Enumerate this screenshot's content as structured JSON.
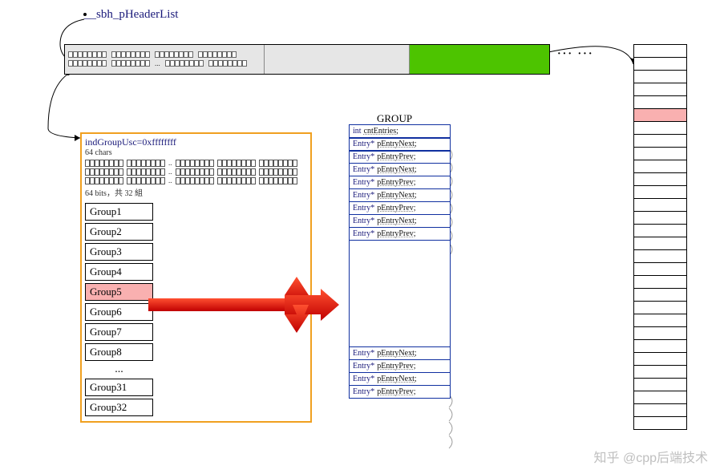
{
  "header": {
    "label": "__sbh_pHeaderList",
    "trailing_dots": "··· ···"
  },
  "orange": {
    "ind_label": "indGroupUsc=0xffffffff",
    "chars_label": "64 chars",
    "note": "64 bits，共 32 組",
    "groups": [
      "Group1",
      "Group2",
      "Group3",
      "Group4",
      "Group5",
      "Group6",
      "Group7",
      "Group8"
    ],
    "groups_dots": "...",
    "groups_tail": [
      "Group31",
      "Group32"
    ],
    "highlight_index": 4
  },
  "group_struct": {
    "title": "GROUP",
    "rows_top": [
      {
        "t1": "int",
        "t2": "cntEntries;"
      },
      {
        "t1": "Entry*",
        "t2": "pEntryNext;"
      },
      {
        "t1": "Entry*",
        "t2": "pEntryPrev;"
      },
      {
        "t1": "Entry*",
        "t2": "pEntryNext;"
      },
      {
        "t1": "Entry*",
        "t2": "pEntryPrev;"
      },
      {
        "t1": "Entry*",
        "t2": "pEntryNext;"
      },
      {
        "t1": "Entry*",
        "t2": "pEntryPrev;"
      },
      {
        "t1": "Entry*",
        "t2": "pEntryNext;"
      },
      {
        "t1": "Entry*",
        "t2": "pEntryPrev;"
      }
    ],
    "rows_bottom": [
      {
        "t1": "Entry*",
        "t2": "pEntryNext;"
      },
      {
        "t1": "Entry*",
        "t2": "pEntryPrev;"
      },
      {
        "t1": "Entry*",
        "t2": "pEntryNext;"
      },
      {
        "t1": "Entry*",
        "t2": "pEntryPrev;"
      }
    ]
  },
  "right_column": {
    "cell_count": 30,
    "red_index": 5
  },
  "watermark": "知乎 @cpp后端技术"
}
